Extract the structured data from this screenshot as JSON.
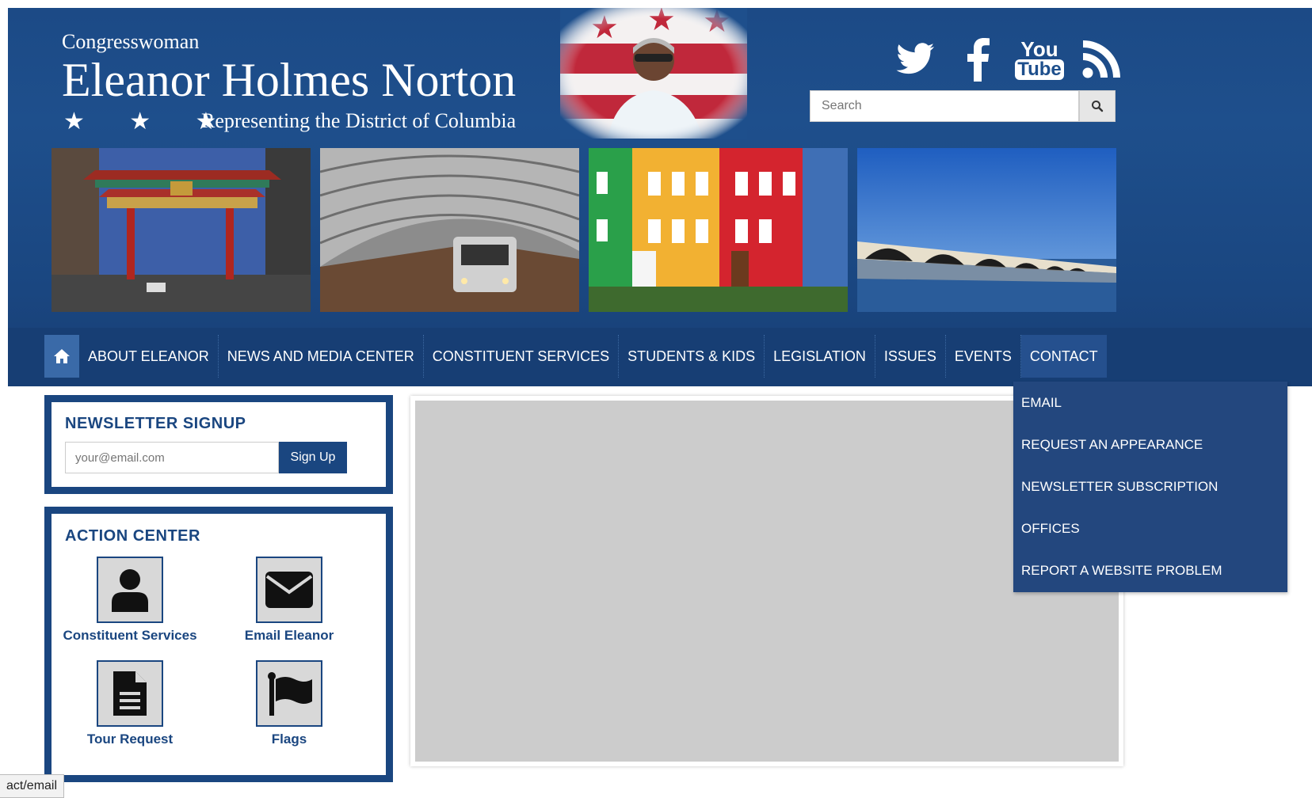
{
  "header": {
    "pre_title": "Congresswoman",
    "name": "Eleanor Holmes Norton",
    "stars": "★ ★ ★",
    "subtitle": "Representing the District of Columbia"
  },
  "social": {
    "twitter": "twitter-icon",
    "facebook": "facebook-icon",
    "youtube_top": "You",
    "youtube_bottom": "Tube",
    "rss": "rss-icon"
  },
  "search": {
    "placeholder": "Search"
  },
  "nav": {
    "items": [
      {
        "label": "ABOUT ELEANOR"
      },
      {
        "label": "NEWS AND MEDIA CENTER"
      },
      {
        "label": "CONSTITUENT SERVICES"
      },
      {
        "label": "STUDENTS & KIDS"
      },
      {
        "label": "LEGISLATION"
      },
      {
        "label": "ISSUES"
      },
      {
        "label": "EVENTS"
      },
      {
        "label": "CONTACT"
      }
    ],
    "active": "CONTACT"
  },
  "contact_menu": {
    "items": [
      {
        "label": "EMAIL"
      },
      {
        "label": "REQUEST AN APPEARANCE"
      },
      {
        "label": "NEWSLETTER SUBSCRIPTION"
      },
      {
        "label": "OFFICES"
      },
      {
        "label": "REPORT A WEBSITE PROBLEM"
      }
    ]
  },
  "newsletter": {
    "title": "NEWSLETTER SIGNUP",
    "placeholder": "your@email.com",
    "button": "Sign Up"
  },
  "action_center": {
    "title": "ACTION CENTER",
    "tiles": [
      {
        "label": "Constituent Services",
        "icon": "person-icon"
      },
      {
        "label": "Email Eleanor",
        "icon": "envelope-icon"
      },
      {
        "label": "Tour Request",
        "icon": "document-icon"
      },
      {
        "label": "Flags",
        "icon": "flag-icon"
      }
    ]
  },
  "status_bar": {
    "url": "act/email"
  },
  "colors": {
    "brand_blue": "#1a4680",
    "nav_blue": "#173e74",
    "dropdown_blue": "#23477e",
    "panel_gray": "#cccccc"
  }
}
